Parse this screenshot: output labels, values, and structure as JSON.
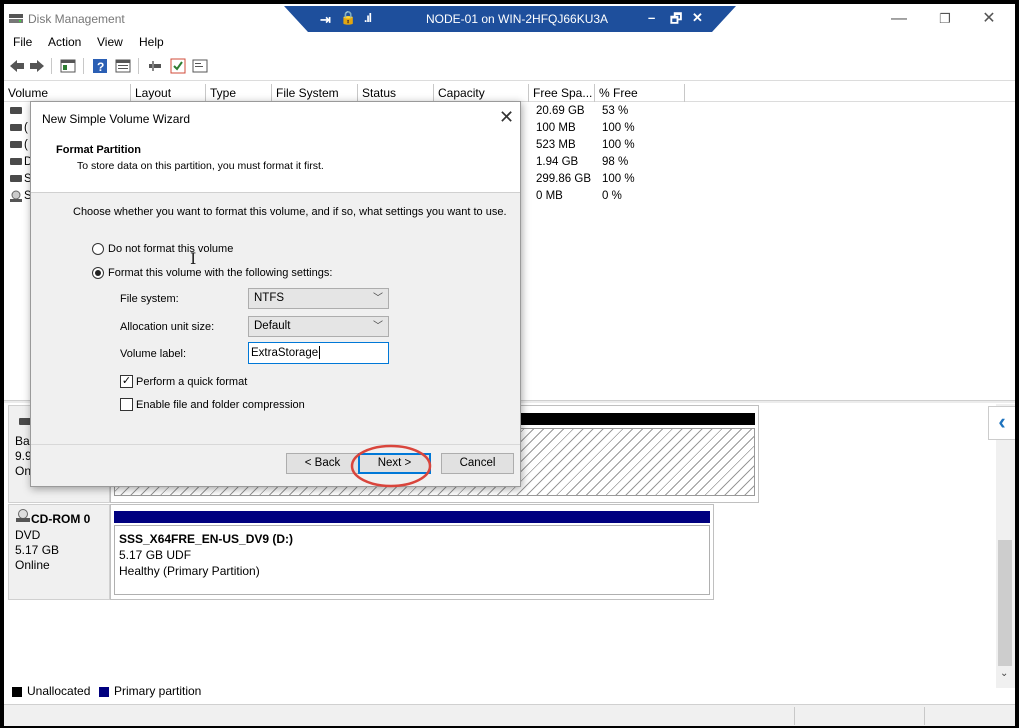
{
  "app": {
    "title": "Disk Management",
    "menu": [
      "File",
      "Action",
      "View",
      "Help"
    ],
    "window_controls": {
      "minimize": "—",
      "restore": "❐",
      "close": "✕"
    }
  },
  "rdp": {
    "title": "NODE-01 on WIN-2HFQJ66KU3A",
    "pin_icon": "⇥",
    "lock_icon": "🔒",
    "signal_icon": ".ıl",
    "minimize": "–",
    "restore": "🗗",
    "close": "✕",
    "bar_color": "#1e4f9c"
  },
  "volume_list": {
    "columns": [
      "Volume",
      "Layout",
      "Type",
      "File System",
      "Status",
      "Capacity",
      "Free Spa...",
      "% Free"
    ],
    "rows": [
      {
        "initial": "",
        "free": "20.69 GB",
        "pct": "53 %"
      },
      {
        "initial": "(",
        "free": "100 MB",
        "pct": "100 %"
      },
      {
        "initial": "(",
        "free": "523 MB",
        "pct": "100 %"
      },
      {
        "initial": "D",
        "free": "1.94 GB",
        "pct": "98 %"
      },
      {
        "initial": "S",
        "free": "299.86 GB",
        "pct": "100 %"
      },
      {
        "initial": "S",
        "free": "0 MB",
        "pct": "0 %"
      }
    ]
  },
  "disks": {
    "disk0": {
      "line1": "Ba",
      "line2": "9.9",
      "line3": "On"
    },
    "cdrom": {
      "name": "CD-ROM 0",
      "type": "DVD",
      "size": "5.17 GB",
      "status": "Online",
      "partition_name": "SSS_X64FRE_EN-US_DV9  (D:)",
      "partition_size": "5.17 GB UDF",
      "partition_status": "Healthy (Primary Partition)"
    }
  },
  "legend": {
    "unallocated": "Unallocated",
    "primary": "Primary partition"
  },
  "wizard": {
    "title": "New Simple Volume Wizard",
    "heading": "Format Partition",
    "subheading": "To store data on this partition, you must format it first.",
    "instruction": "Choose whether you want to format this volume, and if so, what settings you want to use.",
    "option_no_format": "Do not format this volume",
    "option_format": "Format this volume with the following settings:",
    "file_system_label": "File system:",
    "file_system_value": "NTFS",
    "alloc_label": "Allocation unit size:",
    "alloc_value": "Default",
    "volume_label_label": "Volume label:",
    "volume_label_value": "ExtraStorage",
    "quick_format": "Perform a quick format",
    "compression": "Enable file and folder compression",
    "back": "< Back",
    "next": "Next >",
    "cancel": "Cancel",
    "close": "✕"
  }
}
